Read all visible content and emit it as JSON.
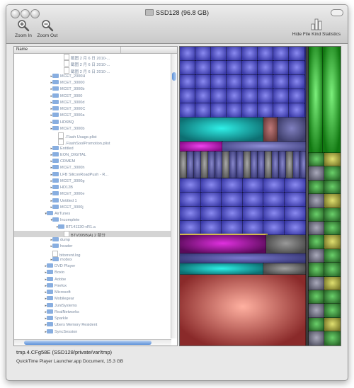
{
  "window": {
    "title": "SSD128 (96.8 GB)"
  },
  "toolbar": {
    "zoom_in_label": "Zoom In",
    "zoom_out_label": "Zoom Out",
    "hide_stats_label": "Hide File Kind Statistics"
  },
  "file_list": {
    "column_header": "Name",
    "rows": [
      {
        "label": "截图 2 月 6 日 2010-...",
        "kind": "file",
        "expanded": false
      },
      {
        "label": "截图 2 月 6 日 2010-...",
        "kind": "file",
        "expanded": false
      },
      {
        "label": "截图 2 月 6 日 2010-...",
        "kind": "file",
        "expanded": false
      },
      {
        "label": "MCET_2000H",
        "kind": "folder",
        "expanded": false
      },
      {
        "label": "MCET_30000",
        "kind": "folder",
        "expanded": false
      },
      {
        "label": "MCET_3000b",
        "kind": "folder",
        "expanded": false
      },
      {
        "label": "MCET_3000",
        "kind": "folder",
        "expanded": false
      },
      {
        "label": "MCET_3000d",
        "kind": "folder",
        "expanded": false
      },
      {
        "label": "MCET_3000C",
        "kind": "folder",
        "expanded": false
      },
      {
        "label": "MCET_3000a",
        "kind": "folder",
        "expanded": false
      },
      {
        "label": "HD6BQ",
        "kind": "folder",
        "expanded": false
      },
      {
        "label": "MCET_3000b",
        "kind": "folder",
        "expanded": false
      },
      {
        "label": ".Flash Usage.plist",
        "kind": "file",
        "expanded": false
      },
      {
        "label": ".FlashSoolPromotion.plist",
        "kind": "file",
        "expanded": false
      },
      {
        "label": "Entitled",
        "kind": "folder",
        "expanded": false
      },
      {
        "label": "EON_DIGITAL",
        "kind": "folder",
        "expanded": false
      },
      {
        "label": "CRMEM",
        "kind": "folder",
        "expanded": false
      },
      {
        "label": "MCET_3000h",
        "kind": "folder",
        "expanded": false
      },
      {
        "label": "LFB SiliconRoadPush - R...",
        "kind": "folder",
        "expanded": false
      },
      {
        "label": "MCET_3000g",
        "kind": "folder",
        "expanded": false
      },
      {
        "label": "HD12B",
        "kind": "folder",
        "expanded": false
      },
      {
        "label": "MCET_3000e",
        "kind": "folder",
        "expanded": false
      },
      {
        "label": "Untitled 1",
        "kind": "folder",
        "expanded": false
      },
      {
        "label": "MCET_3000j",
        "kind": "folder",
        "expanded": false
      },
      {
        "label": "AirTunes",
        "kind": "folder",
        "expanded": true
      },
      {
        "label": "Incomplete",
        "kind": "folder",
        "expanded": true
      },
      {
        "label": "BT141130-vR1.a",
        "kind": "folder",
        "expanded": true
      },
      {
        "label": "BTV095B(A) 2 部分",
        "kind": "file",
        "expanded": false,
        "selected": true
      },
      {
        "label": "dump",
        "kind": "folder",
        "expanded": false
      },
      {
        "label": "header",
        "kind": "folder",
        "expanded": false
      },
      {
        "label": "bitorrent.log",
        "kind": "file",
        "expanded": false
      },
      {
        "label": "mobox",
        "kind": "folder",
        "expanded": false
      },
      {
        "label": "DVD Player",
        "kind": "folder",
        "expanded": false
      },
      {
        "label": "Boxio",
        "kind": "folder",
        "expanded": false
      },
      {
        "label": "Adobe",
        "kind": "folder",
        "expanded": false
      },
      {
        "label": "Firefox",
        "kind": "folder",
        "expanded": false
      },
      {
        "label": "Microsoft",
        "kind": "folder",
        "expanded": false
      },
      {
        "label": "Mobilegear",
        "kind": "folder",
        "expanded": false
      },
      {
        "label": "JuniSystems",
        "kind": "folder",
        "expanded": false
      },
      {
        "label": "RealNetworks",
        "kind": "folder",
        "expanded": false
      },
      {
        "label": "Sparkle",
        "kind": "folder",
        "expanded": false
      },
      {
        "label": "Ubers Memory Resident",
        "kind": "folder",
        "expanded": false
      },
      {
        "label": "SyncSession",
        "kind": "folder",
        "expanded": false
      }
    ]
  },
  "status": {
    "path": "tmp.4.CFg58E (SSD128/private/var/tmp)",
    "detail": "QuickTime Player Launcher.app Document, 15.3 GB"
  },
  "treemap": {
    "selected_color": "#d4b84a"
  }
}
